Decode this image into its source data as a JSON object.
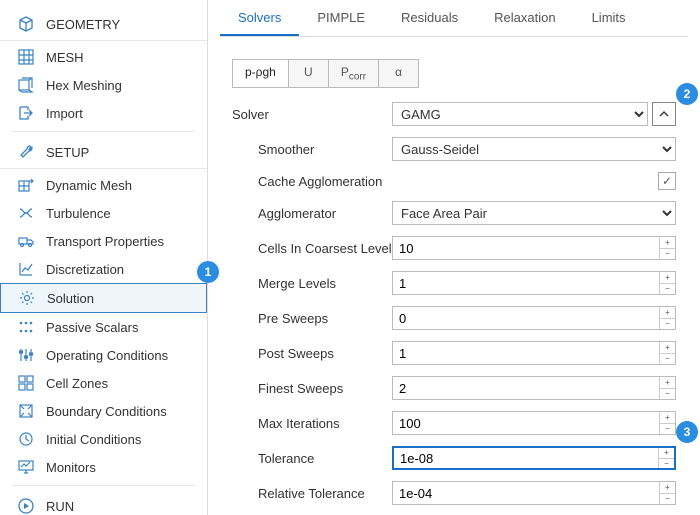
{
  "sidebar": {
    "sections": {
      "geometry": {
        "label": "GEOMETRY"
      },
      "setup": {
        "label": "SETUP"
      },
      "run": {
        "label": "RUN"
      }
    },
    "geometry_items": [
      {
        "label": "MESH"
      },
      {
        "label": "Hex Meshing"
      },
      {
        "label": "Import"
      }
    ],
    "setup_items": [
      {
        "label": "Dynamic Mesh"
      },
      {
        "label": "Turbulence"
      },
      {
        "label": "Transport Properties"
      },
      {
        "label": "Discretization"
      },
      {
        "label": "Solution"
      },
      {
        "label": "Passive Scalars"
      },
      {
        "label": "Operating Conditions"
      },
      {
        "label": "Cell Zones"
      },
      {
        "label": "Boundary Conditions"
      },
      {
        "label": "Initial Conditions"
      },
      {
        "label": "Monitors"
      }
    ]
  },
  "tabs_top": [
    "Solvers",
    "PIMPLE",
    "Residuals",
    "Relaxation",
    "Limits"
  ],
  "sub_tabs": [
    "p-ρgh",
    "U",
    "P",
    "α"
  ],
  "sub_tab2_sub": "corr",
  "form": {
    "solver_label": "Solver",
    "solver_value": "GAMG",
    "smoother_label": "Smoother",
    "smoother_value": "Gauss-Seidel",
    "cache_label": "Cache Agglomeration",
    "agglom_label": "Agglomerator",
    "agglom_value": "Face Area Pair",
    "cells_label": "Cells In Coarsest Level",
    "cells_value": "10",
    "merge_label": "Merge Levels",
    "merge_value": "1",
    "pre_label": "Pre Sweeps",
    "pre_value": "0",
    "post_label": "Post Sweeps",
    "post_value": "1",
    "finest_label": "Finest Sweeps",
    "finest_value": "2",
    "maxit_label": "Max Iterations",
    "maxit_value": "100",
    "tol_label": "Tolerance",
    "tol_value": "1e-08",
    "reltol_label": "Relative Tolerance",
    "reltol_value": "1e-04"
  },
  "badges": {
    "b1": "1",
    "b2": "2",
    "b3": "3"
  }
}
